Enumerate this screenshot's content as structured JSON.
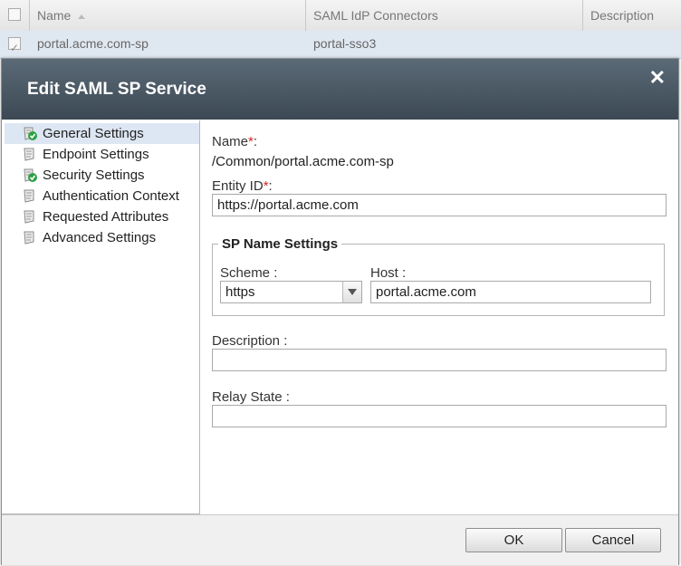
{
  "grid": {
    "columns": [
      "Name",
      "SAML IdP Connectors",
      "Description"
    ],
    "row": {
      "name": "portal.acme.com-sp",
      "connector": "portal-sso3",
      "description": ""
    }
  },
  "dialog": {
    "title": "Edit SAML SP Service",
    "nav": [
      {
        "label": "General Settings",
        "icon": "scroll-check-icon",
        "active": true
      },
      {
        "label": "Endpoint Settings",
        "icon": "scroll-icon"
      },
      {
        "label": "Security Settings",
        "icon": "scroll-check-icon"
      },
      {
        "label": "Authentication Context",
        "icon": "scroll-icon"
      },
      {
        "label": "Requested Attributes",
        "icon": "scroll-icon"
      },
      {
        "label": "Advanced Settings",
        "icon": "scroll-icon"
      }
    ],
    "form": {
      "name_label": "Name",
      "req_mark": "*",
      "name_colon": ":",
      "name_value": "/Common/portal.acme.com-sp",
      "entity_label": "Entity ID",
      "entity_value": "https://portal.acme.com",
      "sp_legend": "SP Name Settings",
      "scheme_label": "Scheme :",
      "scheme_value": "https",
      "host_label": "Host :",
      "host_value": "portal.acme.com",
      "description_label": "Description :",
      "description_value": "",
      "relay_label": "Relay State :",
      "relay_value": ""
    },
    "buttons": {
      "ok": "OK",
      "cancel": "Cancel"
    }
  },
  "colors": {
    "title_bar": "#3c4954",
    "selected_row": "#dfe8f1",
    "check_green": "#2ea043"
  }
}
